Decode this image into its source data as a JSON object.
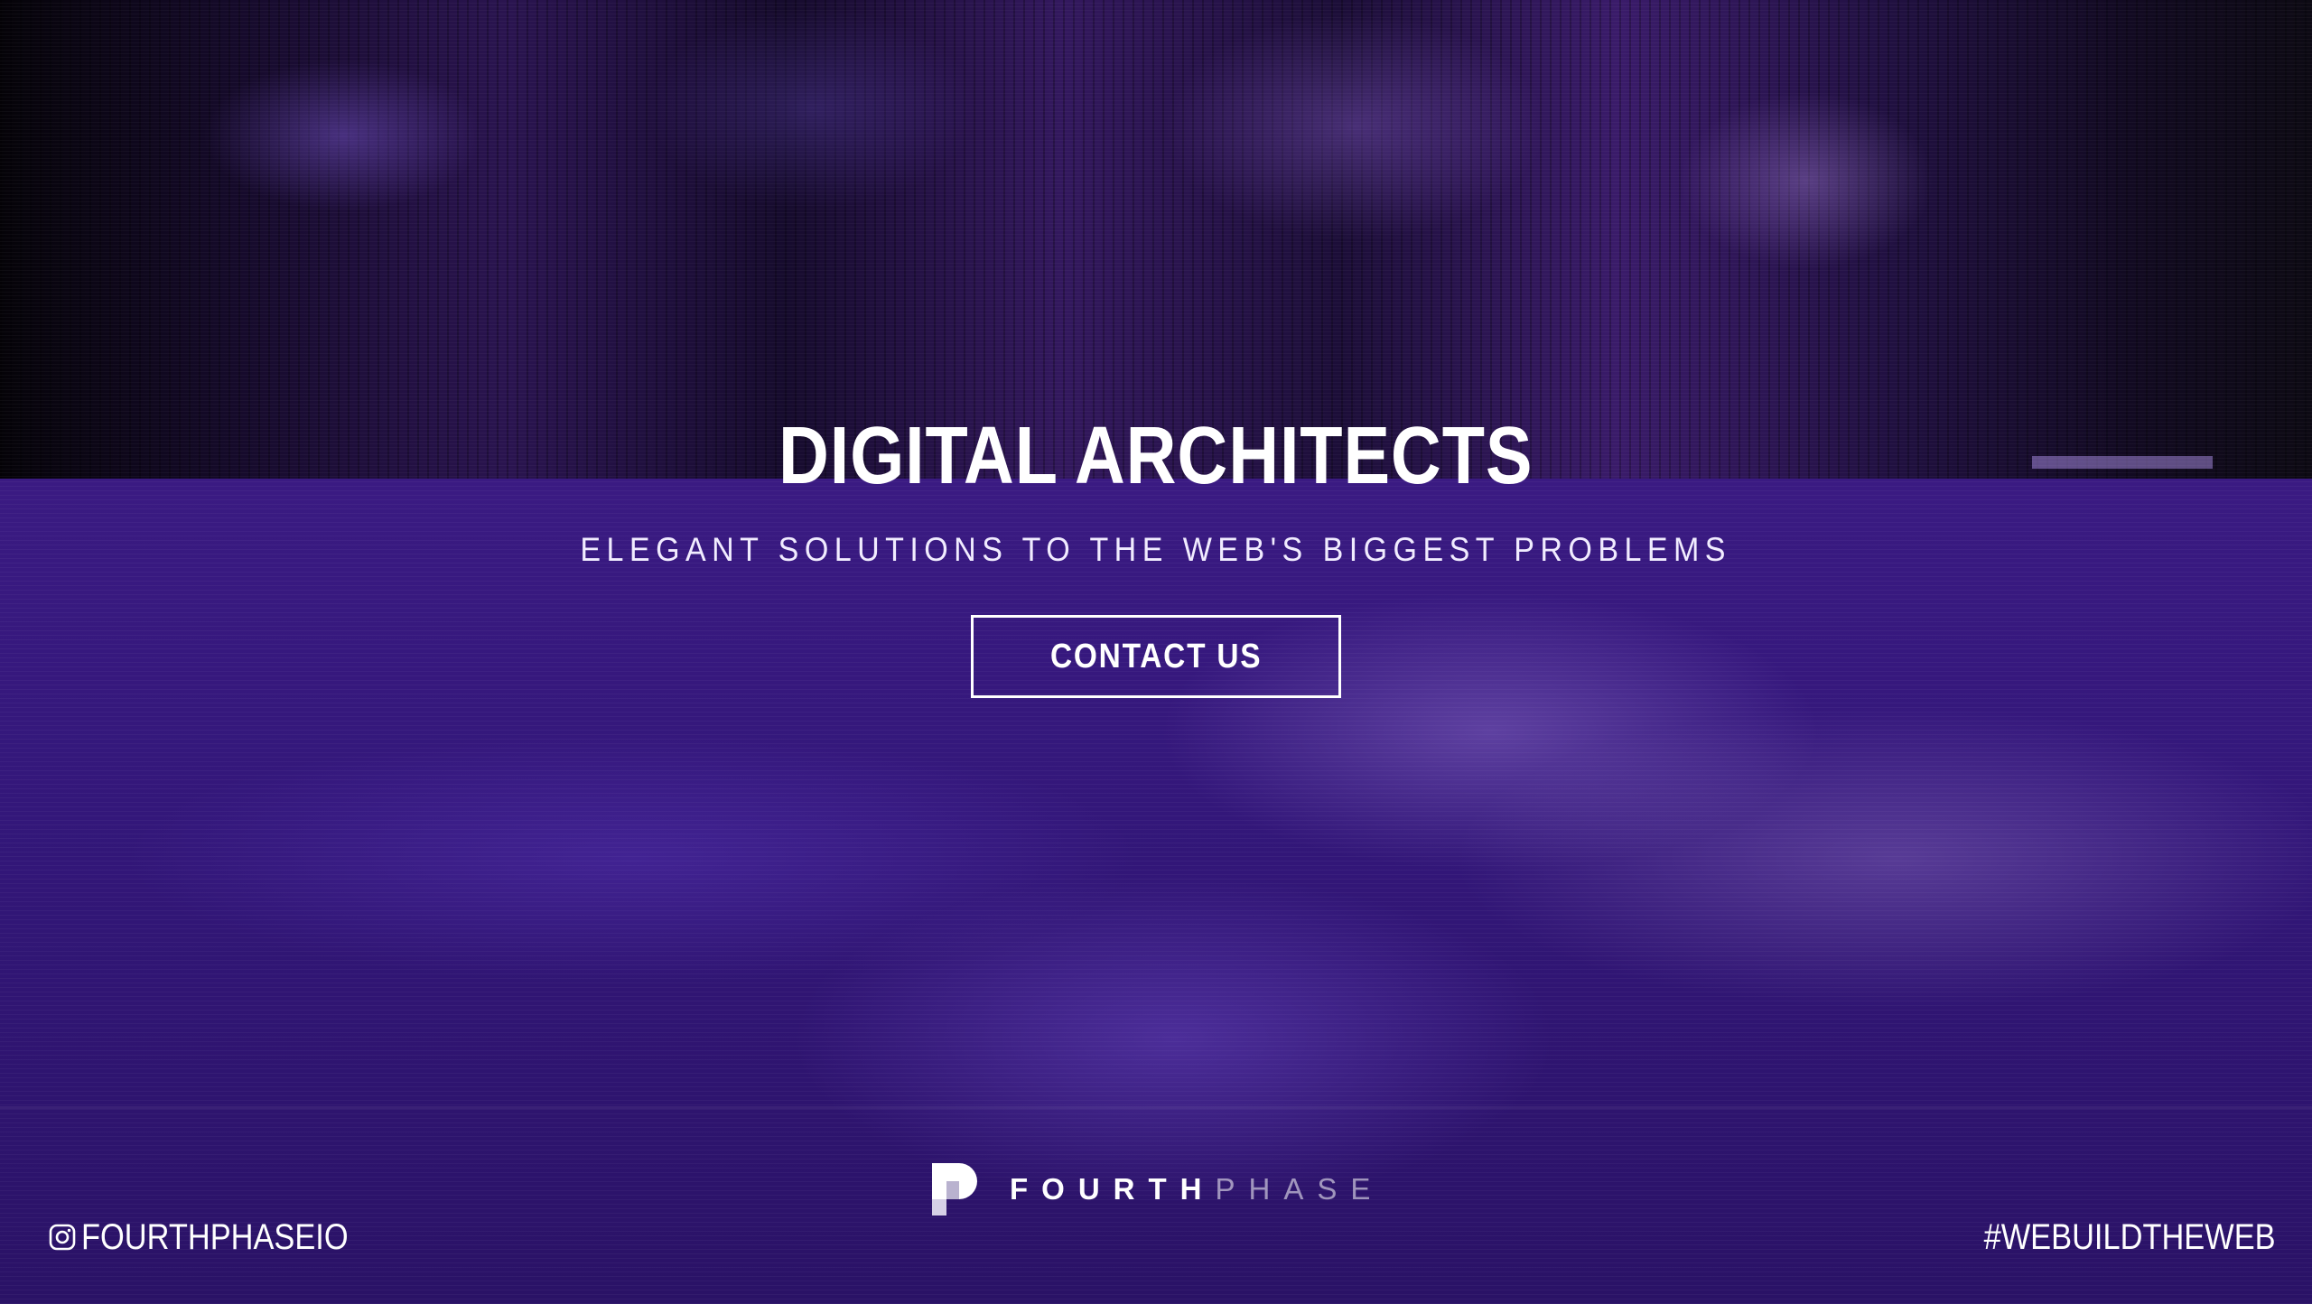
{
  "hero": {
    "title": "DIGITAL ARCHITECTS",
    "subtitle": "ELEGANT SOLUTIONS TO THE WEB'S BIGGEST PROBLEMS",
    "cta_label": "CONTACT US"
  },
  "brand": {
    "name_strong": "FOURTH",
    "name_light": "PHASE",
    "logo_icon": "fourthphase-logo-icon"
  },
  "footer": {
    "instagram_icon": "instagram-icon",
    "instagram_handle": "FOURTHPHASEIO",
    "hashtag": "#WEBUILDTHEWEB"
  },
  "colors": {
    "accent_purple": "#3a1a82",
    "text": "#ffffff"
  }
}
